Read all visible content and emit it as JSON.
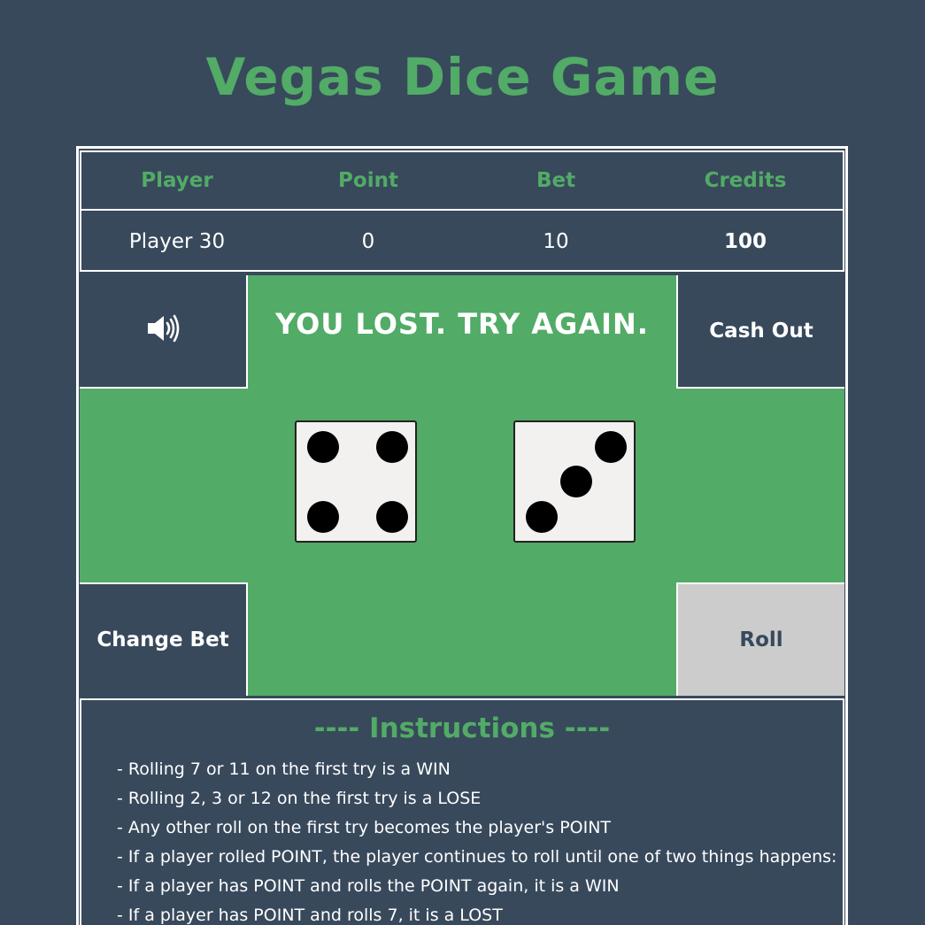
{
  "title": "Vegas Dice Game",
  "scoreboard": {
    "headers": [
      "Player",
      "Point",
      "Bet",
      "Credits"
    ],
    "values": [
      "Player 30",
      "0",
      "10",
      "100"
    ]
  },
  "board": {
    "sound_icon": "speaker-volume-icon",
    "message": "YOU LOST. TRY AGAIN.",
    "cash_out_label": "Cash Out",
    "change_bet_label": "Change Bet",
    "roll_label": "Roll",
    "dice": [
      4,
      3
    ]
  },
  "instructions": {
    "title": "---- Instructions ----",
    "items": [
      "- Rolling 7 or 11 on the first try is a WIN",
      "- Rolling 2, 3 or 12 on the first try is a LOSE",
      "- Any other roll on the first try becomes the player's POINT",
      "- If a player rolled POINT, the player continues to roll until one of two things happens:",
      "- If a player has POINT and rolls the POINT again, it is a WIN",
      "- If a player has POINT and rolls 7, it is a LOST"
    ]
  },
  "colors": {
    "background": "#38495c",
    "accent_green": "#52ab66",
    "roll_button": "#cccccc"
  }
}
